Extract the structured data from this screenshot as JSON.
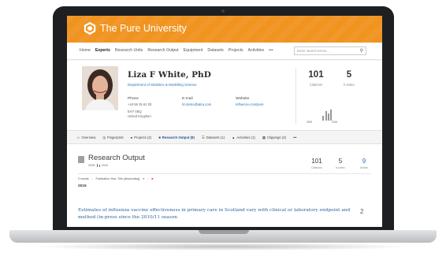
{
  "topbar": {
    "brand": "The Pure University",
    "color": "#f0931f"
  },
  "nav": {
    "items": [
      "Home",
      "Experts",
      "Research Units",
      "Research Output",
      "Equipment",
      "Datasets",
      "Projects",
      "Activities",
      "•••"
    ],
    "active": "Experts",
    "search_placeholder": "Enter search terms..."
  },
  "profile": {
    "name": "Liza F White, PhD",
    "department": "Department of Statistics & Modelling Science",
    "phone_label": "Phone",
    "phone_value": "+44 56 25 61 00",
    "address_1": "EH7 4BQ",
    "address_2": "United Kingdom",
    "email_label": "E-mail",
    "email_value": "liz.demo@atira.com",
    "website_label": "Website",
    "website_value": "Influence.com/pure",
    "citations_value": "101",
    "citations_label": "Citations",
    "hindex_value": "5",
    "hindex_label": "h-index",
    "chart_start": "2005",
    "chart_end": "2015"
  },
  "tabs": {
    "items": [
      "Overview",
      "Fingerprint",
      "Projects (2)",
      "Research Output (9)",
      "Datasets (1)",
      "Activities (1)",
      "Clippings (3)",
      "•••"
    ],
    "icons": [
      "person-icon",
      "fingerprint-icon",
      "projects-icon",
      "book-icon",
      "datasets-icon",
      "activities-icon",
      "clippings-icon",
      "more-icon"
    ],
    "active": "Research Output (9)"
  },
  "research": {
    "title": "Research Output",
    "year_from": "2005",
    "year_to": "2015",
    "citations_value": "101",
    "citations_label": "Citations",
    "hindex_value": "5",
    "hindex_label": "h-index",
    "articles_value": "9",
    "articles_label": "Article",
    "results_label": "9 results",
    "sort_label": "Publication Year, Title (descending)",
    "year_heading": "2015",
    "pub_title": "Estimates of influenza vaccine effectiveness in primary care in Scotland vary with clinical or laboratory endpoint and method (in-press since the 2010/11 season",
    "pub_count": "2"
  }
}
